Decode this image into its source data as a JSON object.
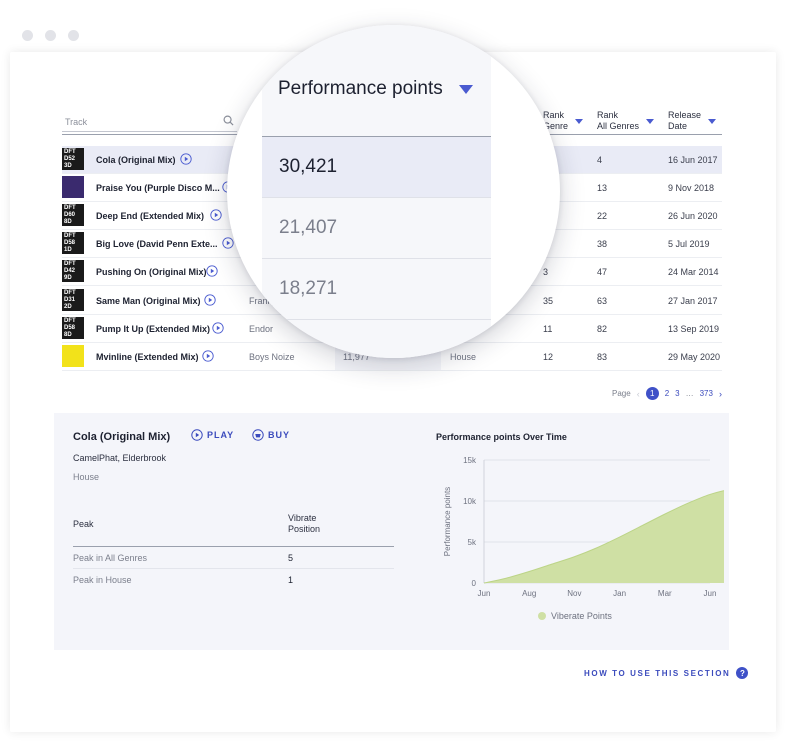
{
  "search": {
    "placeholder": "Track"
  },
  "columns": {
    "rank_genre": [
      "Rank",
      "Genre"
    ],
    "rank_all": [
      "Rank",
      "All Genres"
    ],
    "release": [
      "Release",
      "Date"
    ]
  },
  "rows": [
    {
      "thumb": "DFT D52 3D",
      "track": "Cola (Original Mix)",
      "artist": "",
      "points": "",
      "genre": "",
      "rank_genre": "1",
      "rank_all": "4",
      "date": "16 Jun 2017"
    },
    {
      "thumb": "",
      "track": "Praise You (Purple Disco M...",
      "artist": "",
      "points": "",
      "genre": "",
      "rank_genre": "2",
      "rank_all": "13",
      "date": "9 Nov 2018"
    },
    {
      "thumb": "DFT D60 8D",
      "track": "Deep End (Extended Mix)",
      "artist": "",
      "points": "",
      "genre": "",
      "rank_genre": "4",
      "rank_all": "22",
      "date": "26 Jun 2020"
    },
    {
      "thumb": "DFT D58 1D",
      "track": "Big Love (David Penn Exte...",
      "artist": "",
      "points": "",
      "genre": "",
      "rank_genre": "7",
      "rank_all": "38",
      "date": "5 Jul 2019"
    },
    {
      "thumb": "DFT D42 9D",
      "track": "Pushing On (Original Mix)",
      "artist": "O",
      "points": "",
      "genre": "e",
      "rank_genre": "3",
      "rank_all": "47",
      "date": "24 Mar 2014"
    },
    {
      "thumb": "DFT D31 2D",
      "track": "Same Man (Original Mix)",
      "artist": "Franky l",
      "points": "",
      "genre": "House",
      "rank_genre": "35",
      "rank_all": "63",
      "date": "27 Jan 2017"
    },
    {
      "thumb": "DFT D58 8D",
      "track": "Pump It Up (Extended Mix)",
      "artist": "Endor",
      "points": "",
      "genre": "House",
      "rank_genre": "11",
      "rank_all": "82",
      "date": "13 Sep 2019"
    },
    {
      "thumb": "",
      "track": "Mvinline (Extended Mix)",
      "artist": "Boys Noize",
      "points": "11,977",
      "genre": "House",
      "rank_genre": "12",
      "rank_all": "83",
      "date": "29 May 2020"
    }
  ],
  "pager": {
    "label": "Page",
    "pages": [
      "1",
      "2",
      "3",
      "373"
    ],
    "current": "1"
  },
  "magnifier": {
    "header": "Performance points",
    "values": [
      "30,421",
      "21,407",
      "18,271"
    ]
  },
  "detail": {
    "title": "Cola (Original Mix)",
    "play": "PLAY",
    "buy": "BUY",
    "artists": "CamelPhat, Elderbrook",
    "genre": "House",
    "peak_header": "Peak",
    "position_header": "Vibrate Position",
    "peaks": [
      {
        "label": "Peak in All Genres",
        "value": "5"
      },
      {
        "label": "Peak in House",
        "value": "1"
      }
    ]
  },
  "chart_data": {
    "type": "area",
    "title": "Performance points Over Time",
    "ylabel": "Performance points",
    "x": [
      "Jun",
      "Aug",
      "Nov",
      "Jan",
      "Mar",
      "Jun"
    ],
    "ylim": [
      0,
      15000
    ],
    "yticks": [
      "0",
      "5k",
      "10k",
      "15k"
    ],
    "series": [
      {
        "name": "Viberate Points",
        "color": "#cfe0a4",
        "points": [
          [
            0,
            0
          ],
          [
            0.5,
            600
          ],
          [
            1,
            1400
          ],
          [
            1.5,
            2300
          ],
          [
            2,
            3200
          ],
          [
            2.5,
            4300
          ],
          [
            3,
            5600
          ],
          [
            3.5,
            7000
          ],
          [
            4,
            8400
          ],
          [
            4.5,
            9700
          ],
          [
            5,
            10800
          ],
          [
            5.5,
            11500
          ],
          [
            6,
            12000
          ]
        ]
      }
    ],
    "grid": true,
    "legend": "bottom"
  },
  "help": {
    "label": "HOW TO USE THIS SECTION",
    "icon": "?"
  },
  "colors": {
    "accent": "#3f51c8",
    "area": "#cfe0a4",
    "active_row": "#e9ebf6"
  }
}
